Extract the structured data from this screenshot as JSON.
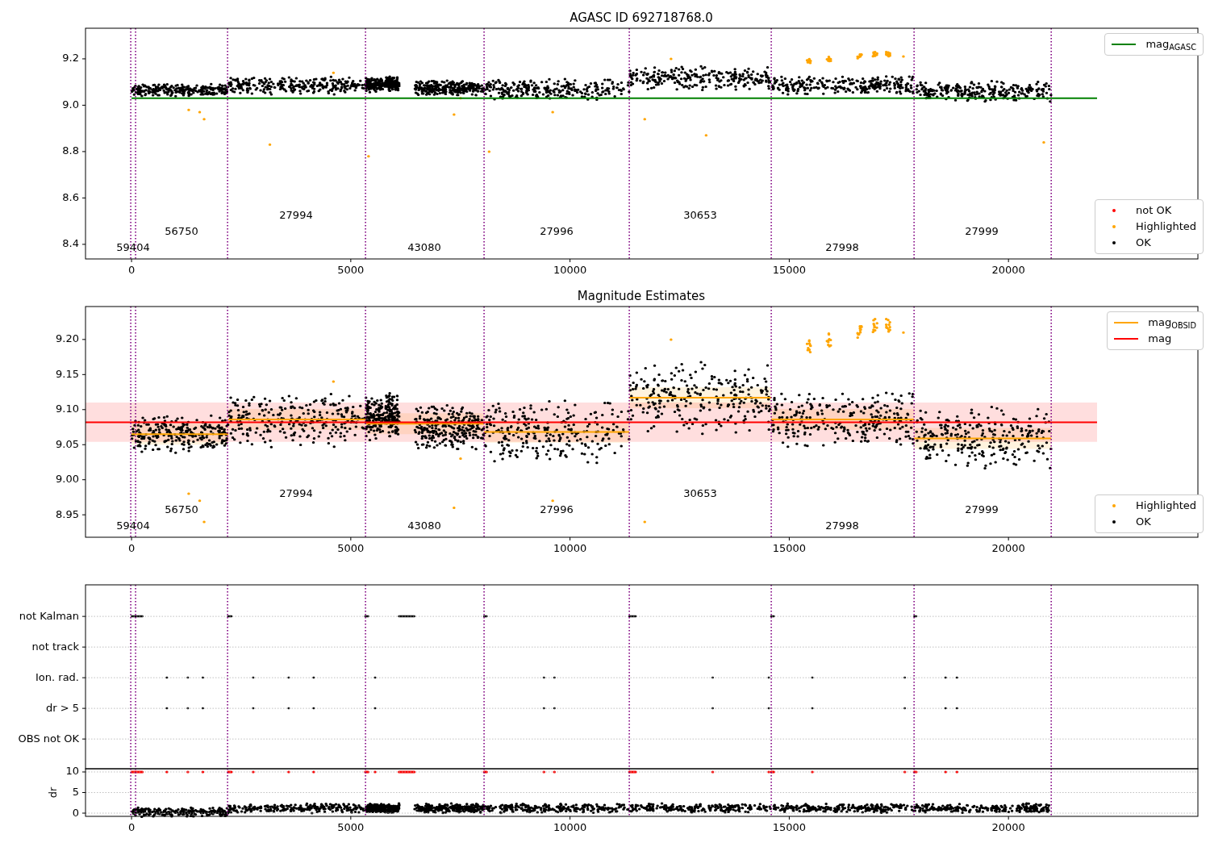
{
  "panels": [
    {
      "title": "AGASC ID 692718768.0",
      "chart_data": {
        "type": "line",
        "xlim": [
          -1050,
          24320
        ],
        "ylim": [
          8.337,
          9.332
        ],
        "xticks": [
          0,
          5000,
          10000,
          15000,
          20000
        ],
        "yticks": [
          {
            "value": 8.4,
            "label": "8.4"
          },
          {
            "value": 8.6,
            "label": "8.6"
          },
          {
            "value": 8.8,
            "label": "8.8"
          },
          {
            "value": 9.0,
            "label": "9.0"
          },
          {
            "value": 9.2,
            "label": "9.2"
          }
        ],
        "x": [
          0,
          22020
        ],
        "series": [
          {
            "name": "mag$_{AGASC}$",
            "color": "#008000",
            "values": [
              9.03,
              9.03
            ]
          }
        ],
        "annotations": [
          "59404",
          "56750",
          "27994",
          "43080",
          "27996",
          "30653",
          "27998",
          "27999"
        ]
      },
      "marker_legend": [
        {
          "label": "not OK",
          "color": "#ff0000"
        },
        {
          "label": "Highlighted",
          "color": "#ffa500"
        },
        {
          "label": "OK",
          "color": "#000000"
        }
      ]
    },
    {
      "title": "Magnitude Estimates",
      "chart_data": {
        "type": "line",
        "xlim": [
          -1050,
          24320
        ],
        "ylim": [
          8.918,
          9.247
        ],
        "xticks": [
          0,
          5000,
          10000,
          15000,
          20000
        ],
        "yticks": [
          {
            "value": 8.95,
            "label": "8.95"
          },
          {
            "value": 9.0,
            "label": "9.00"
          },
          {
            "value": 9.05,
            "label": "9.05"
          },
          {
            "value": 9.1,
            "label": "9.10"
          },
          {
            "value": 9.15,
            "label": "9.15"
          },
          {
            "value": 9.2,
            "label": "9.20"
          }
        ],
        "x": [
          -1050,
          0,
          2208,
          2208,
          2208,
          5336,
          5336,
          5336,
          8040,
          8040,
          8040,
          11352,
          11352,
          11352,
          14590,
          14590,
          14590,
          17847,
          17847,
          17847,
          20975,
          22020
        ],
        "series": [
          {
            "name": "mag$_{OBSID}$",
            "color": "#ffa500",
            "values": [
              null,
              9.065,
              9.065,
              null,
              9.086,
              9.086,
              null,
              9.08,
              9.08,
              null,
              9.068,
              9.068,
              null,
              9.117,
              9.117,
              null,
              9.086,
              9.086,
              null,
              9.059,
              9.059,
              null
            ]
          },
          {
            "name": "mag",
            "color": "#ff0000",
            "values": [
              9.082,
              9.082,
              9.082,
              9.082,
              9.082,
              9.082,
              9.082,
              9.082,
              9.082,
              9.082,
              9.082,
              9.082,
              9.082,
              9.082,
              9.082,
              9.082,
              9.082,
              9.082,
              9.082,
              9.082,
              9.082,
              9.082
            ]
          }
        ],
        "annotations": [
          "59404",
          "56750",
          "27994",
          "43080",
          "27996",
          "30653",
          "27998",
          "27999"
        ]
      },
      "marker_legend": [
        {
          "label": "Highlighted",
          "color": "#ffa500"
        },
        {
          "label": "OK",
          "color": "#000000"
        }
      ]
    },
    {
      "chart_data": {
        "type": "scatter",
        "orientation": "horizontal",
        "grid": true,
        "xlim": [
          -1050,
          24320
        ],
        "categories": [
          "not Kalman",
          "not track",
          "Ion. rad.",
          "dr > 5",
          "OBS not OK"
        ]
      }
    },
    {
      "chart_data": {
        "type": "scatter",
        "grid": true,
        "xlim": [
          -1050,
          24320
        ],
        "ylim": [
          -0.78,
          10.78
        ],
        "ylabel": "dr",
        "xticks": [
          0,
          5000,
          10000,
          15000,
          20000
        ],
        "yticks": [
          0,
          5,
          10
        ]
      }
    }
  ]
}
